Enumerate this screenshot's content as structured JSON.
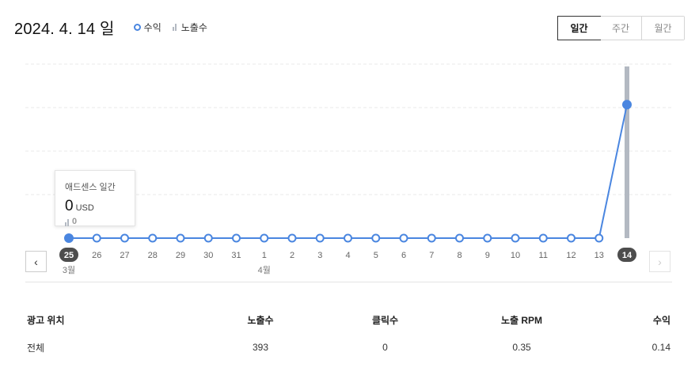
{
  "header": {
    "date_title": "2024. 4. 14 일",
    "legend": {
      "revenue": "수익",
      "impressions": "노출수"
    }
  },
  "period_tabs": [
    {
      "label": "일간",
      "active": true
    },
    {
      "label": "주간",
      "active": false
    },
    {
      "label": "월간",
      "active": false
    }
  ],
  "nav": {
    "prev": "‹",
    "next": "›"
  },
  "tooltip": {
    "title": "애드센스 일간",
    "value": "0",
    "unit": "USD",
    "impressions": "0"
  },
  "colors": {
    "revenue_line": "#4a86e0",
    "impression_bar": "#b3b9c2",
    "selected_tick": "#4d4d4d"
  },
  "chart_data": {
    "type": "line",
    "categories": [
      "25",
      "26",
      "27",
      "28",
      "29",
      "30",
      "31",
      "1",
      "2",
      "3",
      "4",
      "5",
      "6",
      "7",
      "8",
      "9",
      "10",
      "11",
      "12",
      "13",
      "14"
    ],
    "month_labels": [
      {
        "index": 0,
        "label": "3월"
      },
      {
        "index": 7,
        "label": "4월"
      }
    ],
    "selected_index": 20,
    "highlighted_index": 0,
    "series": [
      {
        "name": "수익",
        "type": "line",
        "values": [
          0,
          0,
          0,
          0,
          0,
          0,
          0,
          0,
          0,
          0,
          0,
          0,
          0,
          0,
          0,
          0,
          0,
          0,
          0,
          0,
          0.14
        ]
      },
      {
        "name": "노출수",
        "type": "bar",
        "values": [
          0,
          0,
          0,
          0,
          0,
          0,
          0,
          0,
          0,
          0,
          0,
          0,
          0,
          0,
          0,
          0,
          0,
          0,
          0,
          0,
          393
        ]
      }
    ],
    "ylim_revenue": [
      0,
      0.18
    ],
    "ylim_impressions": [
      0,
      393
    ],
    "grid": true
  },
  "table": {
    "headers": [
      "광고 위치",
      "노출수",
      "클릭수",
      "노출 RPM",
      "수익"
    ],
    "rows": [
      [
        "전체",
        "393",
        "0",
        "0.35",
        "0.14"
      ]
    ]
  }
}
